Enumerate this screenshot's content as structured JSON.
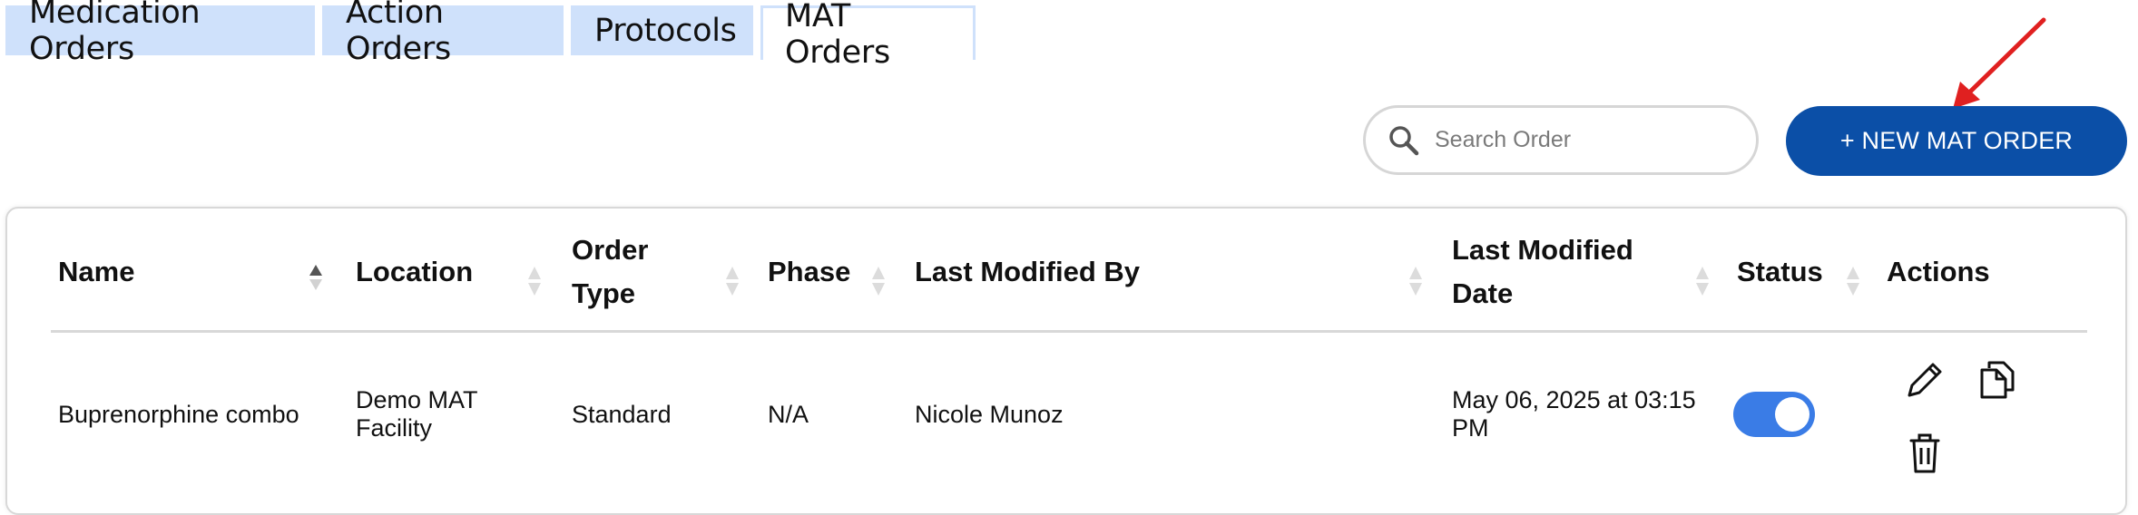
{
  "tabs": [
    {
      "label": "Medication Orders",
      "active": false
    },
    {
      "label": "Action Orders",
      "active": false
    },
    {
      "label": "Protocols",
      "active": false
    },
    {
      "label": "MAT Orders",
      "active": true
    }
  ],
  "search": {
    "placeholder": "Search Order",
    "value": ""
  },
  "new_button": {
    "label": "+ NEW MAT ORDER"
  },
  "table": {
    "headers": {
      "name": "Name",
      "location": "Location",
      "order_type_1": "Order",
      "order_type_2": "Type",
      "phase": "Phase",
      "modified_by": "Last Modified By",
      "modified_date_1": "Last Modified",
      "modified_date_2": "Date",
      "status": "Status",
      "actions": "Actions"
    },
    "rows": [
      {
        "name": "Buprenorphine combo",
        "location_1": "Demo MAT",
        "location_2": "Facility",
        "order_type": "Standard",
        "phase": "N/A",
        "modified_by": "Nicole Munoz",
        "modified_date_1": "May 06, 2025 at 03:15",
        "modified_date_2": "PM",
        "status_on": true
      }
    ]
  },
  "colors": {
    "primary": "#0b4fa7",
    "tab_bg": "#cfe1fb",
    "toggle_on": "#3a7ce6",
    "annotation_arrow": "#e02020"
  },
  "icons": [
    "search-icon",
    "sort-icon",
    "edit-pencil-icon",
    "copy-icon",
    "delete-trash-icon"
  ]
}
